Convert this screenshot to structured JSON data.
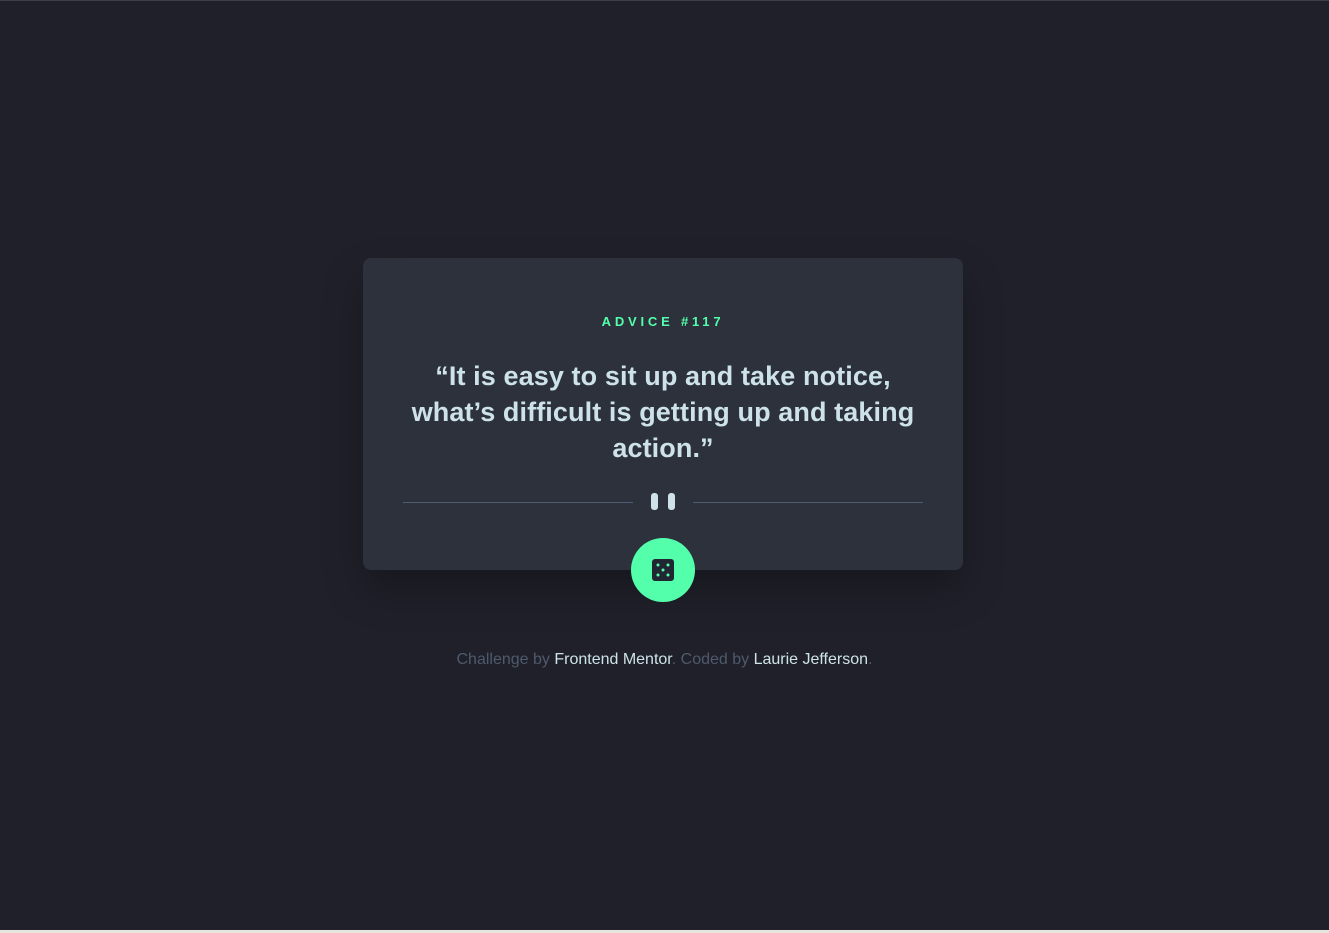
{
  "colors": {
    "background": "#1f2029",
    "card": "#2c313c",
    "accent": "#53ffab",
    "text_light": "#cee3e9",
    "text_muted": "#4f5a6c",
    "divider": "#4e5d73"
  },
  "card": {
    "advice_label": "ADVICE #117",
    "advice_text": "“It is easy to sit up and take notice, what’s difficult is getting up and taking action.”",
    "divider_icon": "pause-icon",
    "button_icon": "dice-icon"
  },
  "footer": {
    "prefix": "Challenge by ",
    "challenge_link": "Frontend Mentor",
    "middle": ". Coded by ",
    "author_link": "Laurie Jefferson",
    "suffix": "."
  }
}
